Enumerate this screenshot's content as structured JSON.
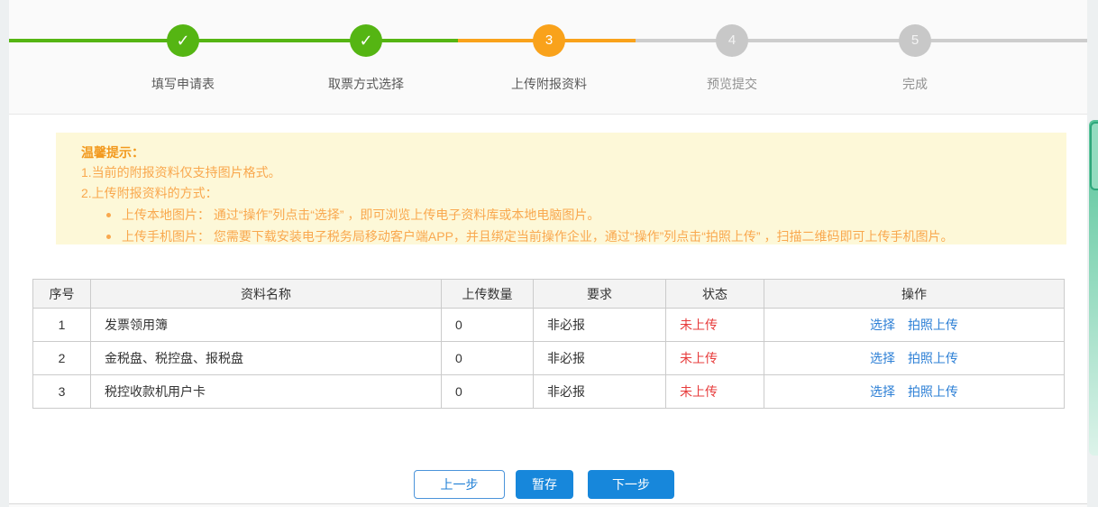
{
  "steps": {
    "items": [
      {
        "label": "填写申请表",
        "state": "done",
        "symbol": "✓"
      },
      {
        "label": "取票方式选择",
        "state": "done",
        "symbol": "✓"
      },
      {
        "label": "上传附报资料",
        "state": "current",
        "symbol": "3"
      },
      {
        "label": "预览提交",
        "state": "pending",
        "symbol": "4"
      },
      {
        "label": "完成",
        "state": "pending",
        "symbol": "5"
      }
    ]
  },
  "tip": {
    "title": "温馨提示：",
    "lines": [
      "1.当前的附报资料仅支持图片格式。",
      "2.上传附报资料的方式："
    ],
    "bullets": [
      "上传本地图片： 通过“操作”列点击“选择” ，即可浏览上传电子资料库或本地电脑图片。",
      "上传手机图片： 您需要下载安装电子税务局移动客户端APP，并且绑定当前操作企业，通过“操作”列点击“拍照上传” ，扫描二维码即可上传手机图片。"
    ]
  },
  "table": {
    "headers": [
      "序号",
      "资料名称",
      "上传数量",
      "要求",
      "状态",
      "操作"
    ],
    "rows": [
      {
        "index": "1",
        "name": "发票领用簿",
        "count": "0",
        "requirement": "非必报",
        "status": "未上传",
        "actions": [
          "选择",
          "拍照上传"
        ]
      },
      {
        "index": "2",
        "name": "金税盘、税控盘、报税盘",
        "count": "0",
        "requirement": "非必报",
        "status": "未上传",
        "actions": [
          "选择",
          "拍照上传"
        ]
      },
      {
        "index": "3",
        "name": "税控收款机用户卡",
        "count": "0",
        "requirement": "非必报",
        "status": "未上传",
        "actions": [
          "选择",
          "拍照上传"
        ]
      }
    ]
  },
  "buttons": {
    "prev": "上一步",
    "save": "暂存",
    "next": "下一步"
  },
  "colors": {
    "green": "#55b513",
    "orange": "#f9a21b",
    "blue": "#1787db",
    "link_blue": "#2e80d6",
    "status_red": "#e73c3c",
    "tip_bg": "#fdf8d8",
    "tip_text": "#f9a84e"
  }
}
